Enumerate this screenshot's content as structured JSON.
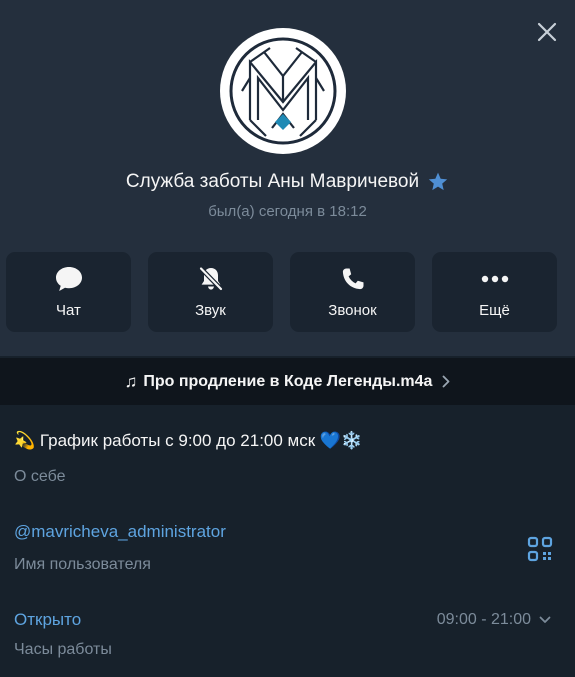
{
  "header": {
    "title": "Служба заботы Аны Мавричевой",
    "status": "был(а) сегодня в 18:12",
    "verified_icon": "star-icon",
    "close_icon": "close-icon"
  },
  "actions": [
    {
      "label": "Чат",
      "icon": "chat-bubble-icon"
    },
    {
      "label": "Звук",
      "icon": "bell-muted-icon"
    },
    {
      "label": "Звонок",
      "icon": "phone-icon"
    },
    {
      "label": "Ещё",
      "icon": "more-dots-icon"
    }
  ],
  "music": {
    "title": "Про продление в Коде Легенды.m4a",
    "note_glyph": "♫"
  },
  "about": {
    "value": "💫 График работы с 9:00 до 21:00 мск 💙❄️",
    "caption": "О себе"
  },
  "username": {
    "value": "@mavricheva_administrator",
    "caption": "Имя пользователя",
    "qr_icon": "qr-code-icon"
  },
  "hours": {
    "state": "Открыто",
    "caption": "Часы работы",
    "range": "09:00 - 21:00"
  },
  "colors": {
    "background": "#17212b",
    "header_bg": "#242f3d",
    "accent": "#5ea4e0",
    "secondary_text": "#7c8b9a"
  }
}
